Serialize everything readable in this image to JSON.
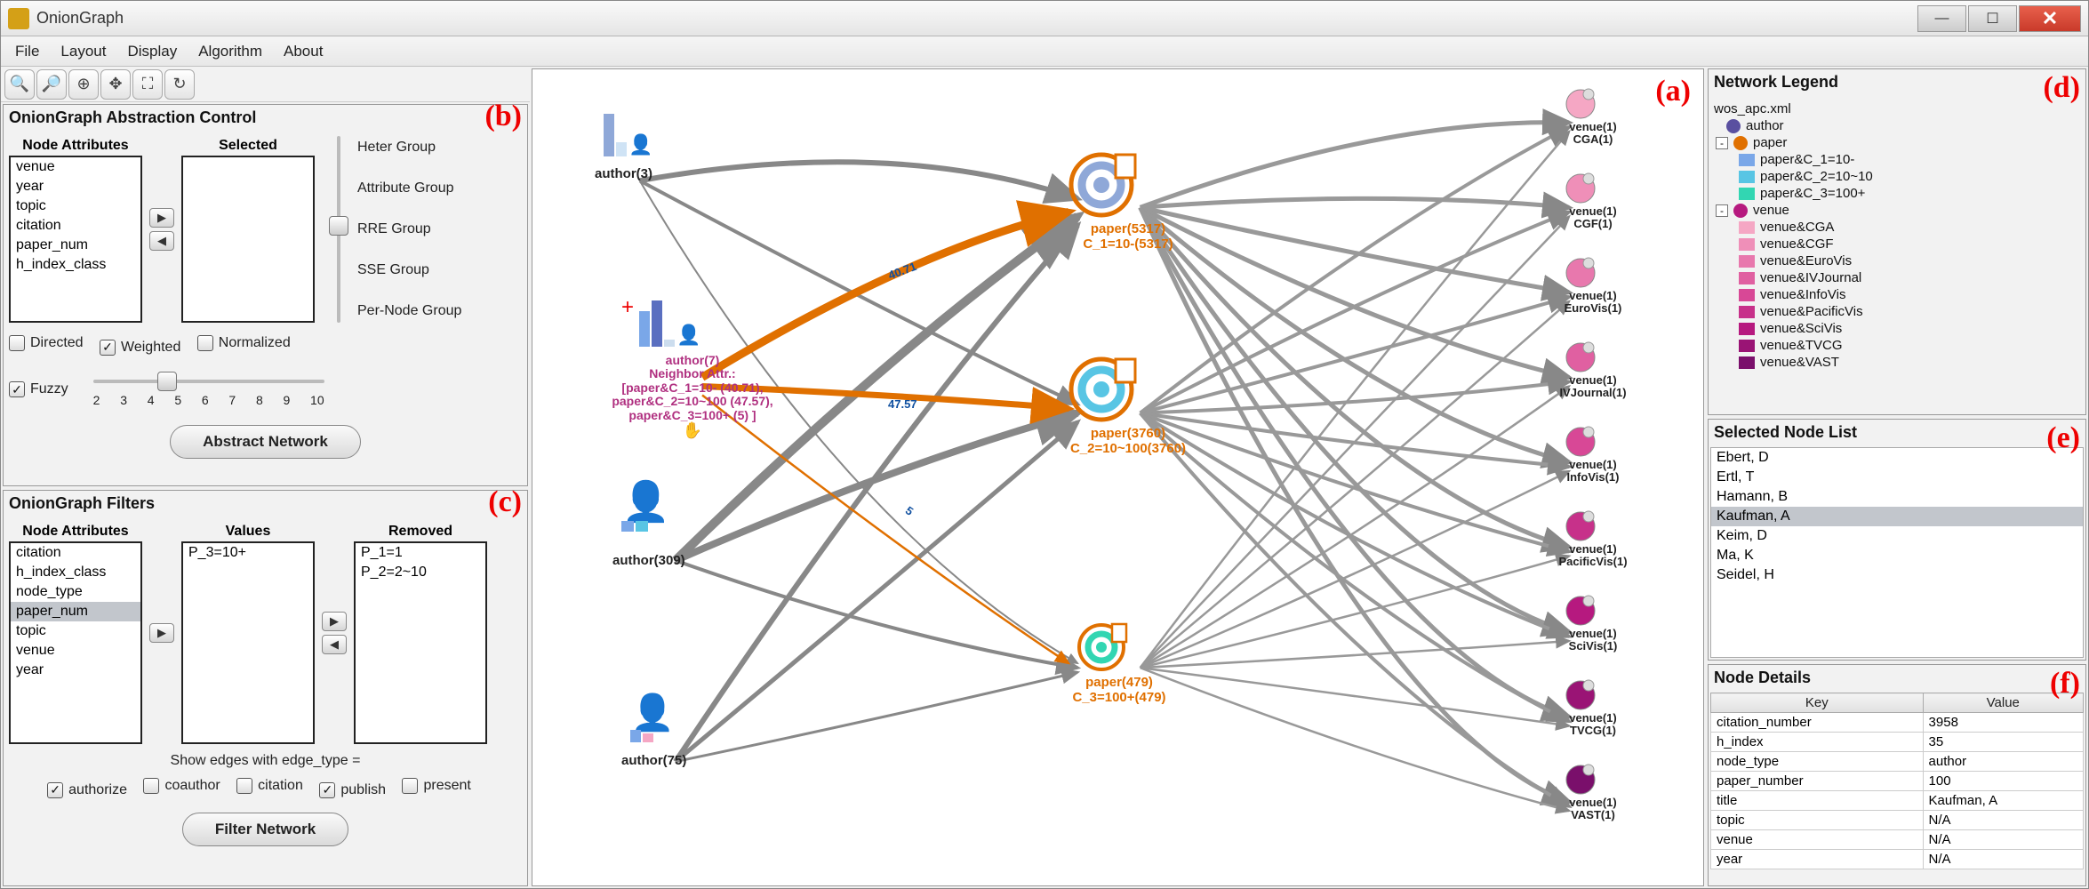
{
  "window": {
    "title": "OnionGraph"
  },
  "menu": [
    "File",
    "Layout",
    "Display",
    "Algorithm",
    "About"
  ],
  "callouts": {
    "a": "(a)",
    "b": "(b)",
    "c": "(c)",
    "d": "(d)",
    "e": "(e)",
    "f": "(f)"
  },
  "abstraction": {
    "title": "OnionGraph Abstraction Control",
    "col_attrs": "Node Attributes",
    "col_selected": "Selected",
    "attrs": [
      "venue",
      "year",
      "topic",
      "citation",
      "paper_num",
      "h_index_class"
    ],
    "groups": [
      "Heter Group",
      "Attribute Group",
      "RRE Group",
      "SSE Group",
      "Per-Node Group"
    ],
    "chk_directed": "Directed",
    "chk_weighted": "Weighted",
    "chk_normalized": "Normalized",
    "chk_fuzzy": "Fuzzy",
    "slider_ticks": [
      "2",
      "3",
      "4",
      "5",
      "6",
      "7",
      "8",
      "9",
      "10"
    ],
    "btn": "Abstract Network"
  },
  "filters": {
    "title": "OnionGraph Filters",
    "col_attrs": "Node Attributes",
    "col_values": "Values",
    "col_removed": "Removed",
    "attrs": [
      "citation",
      "h_index_class",
      "node_type",
      "paper_num",
      "topic",
      "venue",
      "year"
    ],
    "attrs_selected_index": 3,
    "values": [
      "P_3=10+"
    ],
    "removed": [
      "P_1=1",
      "P_2=2~10"
    ],
    "edge_label": "Show edges with edge_type =",
    "chk_authorize": "authorize",
    "chk_coauthor": "coauthor",
    "chk_citation": "citation",
    "chk_publish": "publish",
    "chk_present": "present",
    "btn": "Filter Network"
  },
  "graph": {
    "author3": "author(3)",
    "author7_title": "author(7)",
    "author7_sub1": "Neighbor Attr.:",
    "author7_sub2": "[paper&C_1=10- (40.71),",
    "author7_sub3": "paper&C_2=10~100 (47.57),",
    "author7_sub4": "paper&C_3=100+ (5) ]",
    "author309": "author(309)",
    "author75": "author(75)",
    "paper1a": "paper(5317)",
    "paper1b": "C_1=10-(5317)",
    "paper2a": "paper(3760)",
    "paper2b": "C_2=10~100(3760)",
    "paper3a": "paper(479)",
    "paper3b": "C_3=100+(479)",
    "venue_top": "venue(1)",
    "v_cga": "CGA(1)",
    "v_cgf": "CGF(1)",
    "v_eurovis": "EuroVis(1)",
    "v_ivj": "IVJournal(1)",
    "v_infovis": "InfoVis(1)",
    "v_pac": "PacificVis(1)",
    "v_scivis": "SciVis(1)",
    "v_tvcg": "TVCG(1)",
    "v_vast": "VAST(1)",
    "edge_4071": "40.71",
    "edge_4757": "47.57",
    "edge_5": "5"
  },
  "legend": {
    "title": "Network Legend",
    "root": "wos_apc.xml",
    "author": "author",
    "paper": "paper",
    "p1": "paper&C_1=10-",
    "p2": "paper&C_2=10~10",
    "p3": "paper&C_3=100+",
    "venue": "venue",
    "v": [
      "venue&CGA",
      "venue&CGF",
      "venue&EuroVis",
      "venue&IVJournal",
      "venue&InfoVis",
      "venue&PacificVis",
      "venue&SciVis",
      "venue&TVCG",
      "venue&VAST"
    ]
  },
  "selected_list": {
    "title": "Selected Node List",
    "items": [
      "Ebert, D",
      "Ertl, T",
      "Hamann, B",
      "Kaufman, A",
      "Keim, D",
      "Ma, K",
      "Seidel, H"
    ],
    "selected_index": 3
  },
  "details": {
    "title": "Node Details",
    "key_h": "Key",
    "val_h": "Value",
    "rows": [
      [
        "citation_number",
        "3958"
      ],
      [
        "h_index",
        "35"
      ],
      [
        "node_type",
        "author"
      ],
      [
        "paper_number",
        "100"
      ],
      [
        "title",
        "Kaufman, A"
      ],
      [
        "topic",
        "N/A"
      ],
      [
        "venue",
        "N/A"
      ],
      [
        "year",
        "N/A"
      ]
    ]
  },
  "colors": {
    "p1": "#7aa7e8",
    "p2": "#58c5e4",
    "p3": "#32d6b2",
    "v": [
      "#f5a7c4",
      "#ef8fb8",
      "#e878ad",
      "#e060a1",
      "#d84896",
      "#c7318a",
      "#b6197f",
      "#9a1475",
      "#7a0f6b"
    ]
  }
}
